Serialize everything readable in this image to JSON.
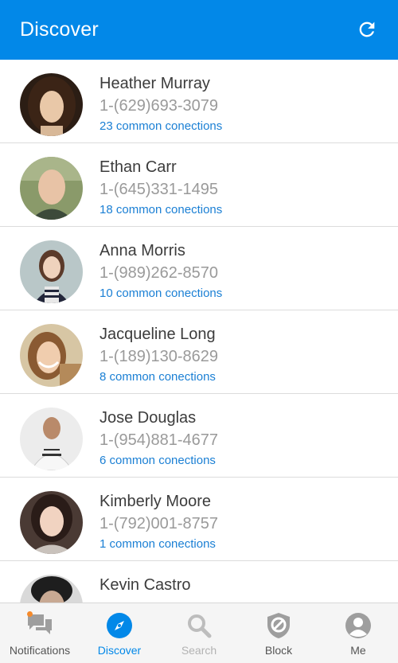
{
  "header": {
    "title": "Discover"
  },
  "contacts": [
    {
      "name": "Heather Murray",
      "phone": "1-(629)693-3079",
      "connections": "23 common conections"
    },
    {
      "name": "Ethan Carr",
      "phone": "1-(645)331-1495",
      "connections": "18 common conections"
    },
    {
      "name": "Anna Morris",
      "phone": "1-(989)262-8570",
      "connections": "10 common conections"
    },
    {
      "name": "Jacqueline Long",
      "phone": "1-(189)130-8629",
      "connections": "8 common conections"
    },
    {
      "name": "Jose Douglas",
      "phone": "1-(954)881-4677",
      "connections": "6 common conections"
    },
    {
      "name": "Kimberly Moore",
      "phone": "1-(792)001-8757",
      "connections": "1 common conections"
    },
    {
      "name": "Kevin Castro",
      "phone": "",
      "connections": ""
    }
  ],
  "tabs": [
    {
      "label": "Notifications",
      "icon": "chat-bubbles-icon",
      "state": "normal"
    },
    {
      "label": "Discover",
      "icon": "compass-icon",
      "state": "active"
    },
    {
      "label": "Search",
      "icon": "search-icon",
      "state": "disabled"
    },
    {
      "label": "Block",
      "icon": "block-shield-icon",
      "state": "normal"
    },
    {
      "label": "Me",
      "icon": "person-icon",
      "state": "normal"
    }
  ],
  "colors": {
    "primary": "#0288e8",
    "link": "#1a7fd4",
    "badge": "#f58a2b"
  }
}
